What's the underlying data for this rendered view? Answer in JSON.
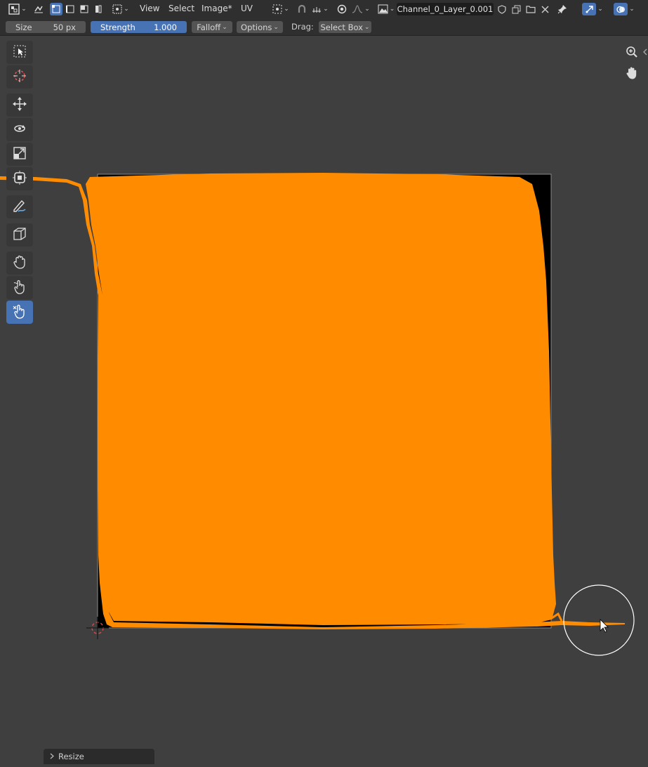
{
  "header": {
    "menus": [
      "View",
      "Select",
      "Image*",
      "UV"
    ],
    "image_name": "Channel_0_Layer_0.001"
  },
  "tool_settings": {
    "size_label": "Size",
    "size_value": "50 px",
    "strength_label": "Strength",
    "strength_value": "1.000",
    "falloff_label": "Falloff",
    "options_label": "Options",
    "drag_label": "Drag:",
    "drag_value": "Select Box"
  },
  "toolbar": {
    "tools": [
      "select-box-icon",
      "cursor-icon",
      "move-icon",
      "rotate-icon",
      "scale-icon",
      "transform-icon",
      "annotate-icon",
      "rip-region-icon",
      "grab-icon",
      "relax-icon",
      "pinch-icon"
    ],
    "active_tool": "pinch-icon"
  },
  "navigation": [
    "zoom-icon",
    "pan-hand-icon"
  ],
  "colors": {
    "uv_fill": "#ff8c00",
    "background": "#3f3f3f",
    "header": "#2f2f2f",
    "accent": "#4772b3",
    "image_bg": "#000000",
    "cursor_red": "#e04848"
  },
  "last_operator": {
    "label": "Resize"
  }
}
